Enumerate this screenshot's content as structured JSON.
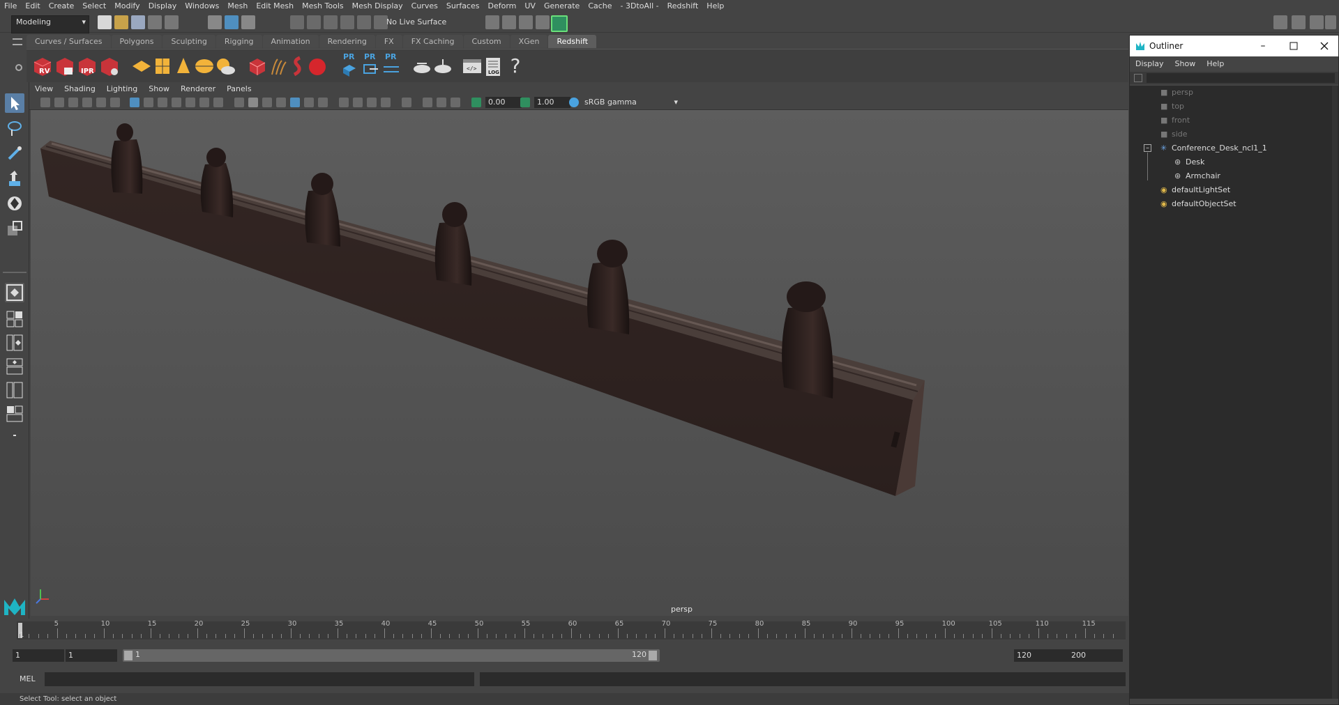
{
  "menubar": {
    "items": [
      "File",
      "Edit",
      "Create",
      "Select",
      "Modify",
      "Display",
      "Windows",
      "Mesh",
      "Edit Mesh",
      "Mesh Tools",
      "Mesh Display",
      "Curves",
      "Surfaces",
      "Deform",
      "UV",
      "Generate",
      "Cache",
      "- 3DtoAll -",
      "Redshift",
      "Help"
    ]
  },
  "statusline": {
    "mode": "Modeling",
    "live_surface": "No Live Surface"
  },
  "shelf": {
    "tabs": [
      "Curves / Surfaces",
      "Polygons",
      "Sculpting",
      "Rigging",
      "Animation",
      "Rendering",
      "FX",
      "FX Caching",
      "Custom",
      "XGen",
      "Redshift"
    ],
    "active_tab": "Redshift",
    "icon_labels": {
      "rv": "RV",
      "ipr": "IPR",
      "pr": "PR",
      "log": "LOG",
      "help": "?"
    }
  },
  "panel": {
    "menus": [
      "View",
      "Shading",
      "Lighting",
      "Show",
      "Renderer",
      "Panels"
    ],
    "exposure": "0.00",
    "gamma": "1.00",
    "color_space": "sRGB gamma"
  },
  "viewport": {
    "camera_label": "persp"
  },
  "timeline": {
    "ticks": [
      "5",
      "10",
      "15",
      "20",
      "25",
      "30",
      "35",
      "40",
      "45",
      "50",
      "55",
      "60",
      "65",
      "70",
      "75",
      "80",
      "85",
      "90",
      "95",
      "100",
      "105",
      "110",
      "115"
    ],
    "current_frame": "1",
    "start_frame": "1",
    "playback_start": "1",
    "range_start_label": "1",
    "range_end_label": "120",
    "end_frame": "120",
    "anim_end": "200"
  },
  "command": {
    "label": "MEL"
  },
  "helpline": {
    "text": "Select Tool: select an object"
  },
  "outliner": {
    "title": "Outliner",
    "menus": [
      "Display",
      "Show",
      "Help"
    ],
    "cameras": [
      "persp",
      "top",
      "front",
      "side"
    ],
    "group": "Conference_Desk_ncl1_1",
    "children": [
      "Desk",
      "Armchair"
    ],
    "sets": [
      "defaultLightSet",
      "defaultObjectSet"
    ]
  },
  "colors": {
    "redshift_red": "#c9343a",
    "accent_blue": "#4aa3e0",
    "outliner_camera_text": "#777777",
    "outliner_text": "#dddddd"
  }
}
